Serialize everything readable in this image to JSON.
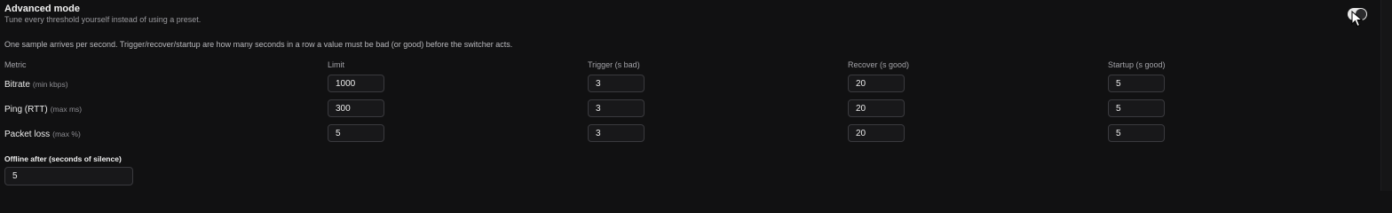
{
  "header": {
    "title": "Advanced mode",
    "subtitle": "Tune every threshold yourself instead of using a preset.",
    "toggle_on": true
  },
  "note": "One sample arrives per second. Trigger/recover/startup are how many seconds in a row a value must be bad (or good) before the switcher acts.",
  "columns": [
    "Metric",
    "Limit",
    "Trigger (s bad)",
    "Recover (s good)",
    "Startup (s good)"
  ],
  "rows": [
    {
      "label": "Bitrate",
      "unit": "(min kbps)",
      "limit": "1000",
      "trigger": "3",
      "recover": "20",
      "startup": "5"
    },
    {
      "label": "Ping (RTT)",
      "unit": "(max ms)",
      "limit": "300",
      "trigger": "3",
      "recover": "20",
      "startup": "5"
    },
    {
      "label": "Packet loss",
      "unit": "(max %)",
      "limit": "5",
      "trigger": "3",
      "recover": "20",
      "startup": "5"
    }
  ],
  "offline": {
    "label": "Offline after (seconds of silence)",
    "value": "5"
  },
  "icons": {
    "toggle": "toggle-switch-icon",
    "cursor": "mouse-pointer-icon"
  },
  "colors": {
    "background": "#111112",
    "field_border": "#3a3a3e",
    "toggle": "#e8e8e8"
  }
}
